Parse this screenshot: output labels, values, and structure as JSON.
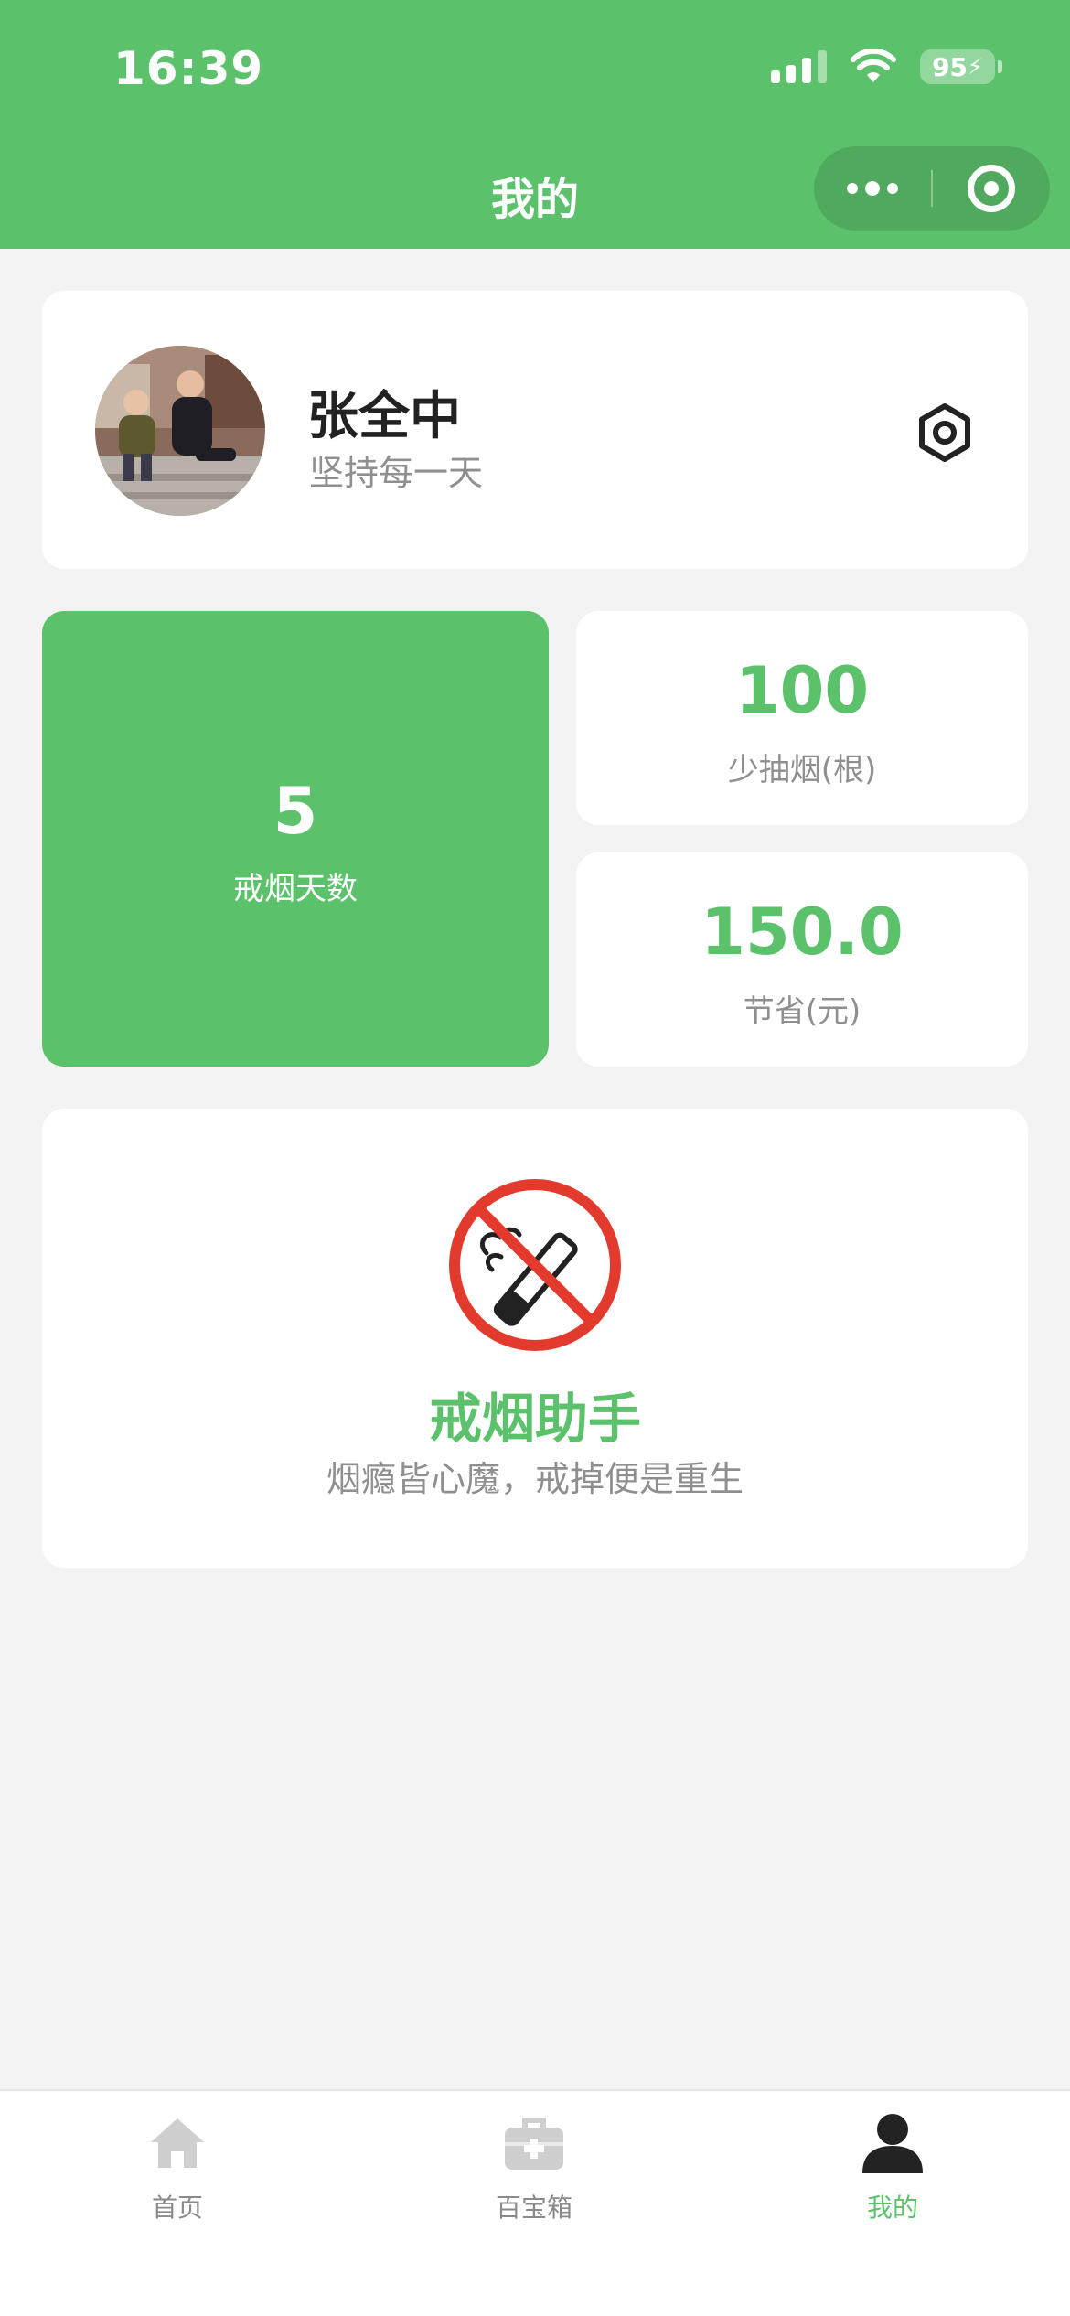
{
  "status_bar": {
    "time": "16:39",
    "battery": "95"
  },
  "nav": {
    "title": "我的"
  },
  "profile": {
    "name": "张全中",
    "motto": "坚持每一天"
  },
  "stats": {
    "days_value": "5",
    "days_label": "戒烟天数",
    "cigs_value": "100",
    "cigs_label": "少抽烟(根)",
    "saved_value": "150.0",
    "saved_label": "节省(元)"
  },
  "banner": {
    "title": "戒烟助手",
    "subtitle": "烟瘾皆心魔，戒掉便是重生"
  },
  "tabbar": {
    "items": [
      {
        "label": "首页",
        "icon": "home-icon"
      },
      {
        "label": "百宝箱",
        "icon": "toolbox-icon"
      },
      {
        "label": "我的",
        "icon": "person-icon"
      }
    ],
    "active_index": 2
  },
  "colors": {
    "accent": "#5bc26b",
    "background": "#f3f3f3",
    "muted_text": "#8f8f8f"
  }
}
